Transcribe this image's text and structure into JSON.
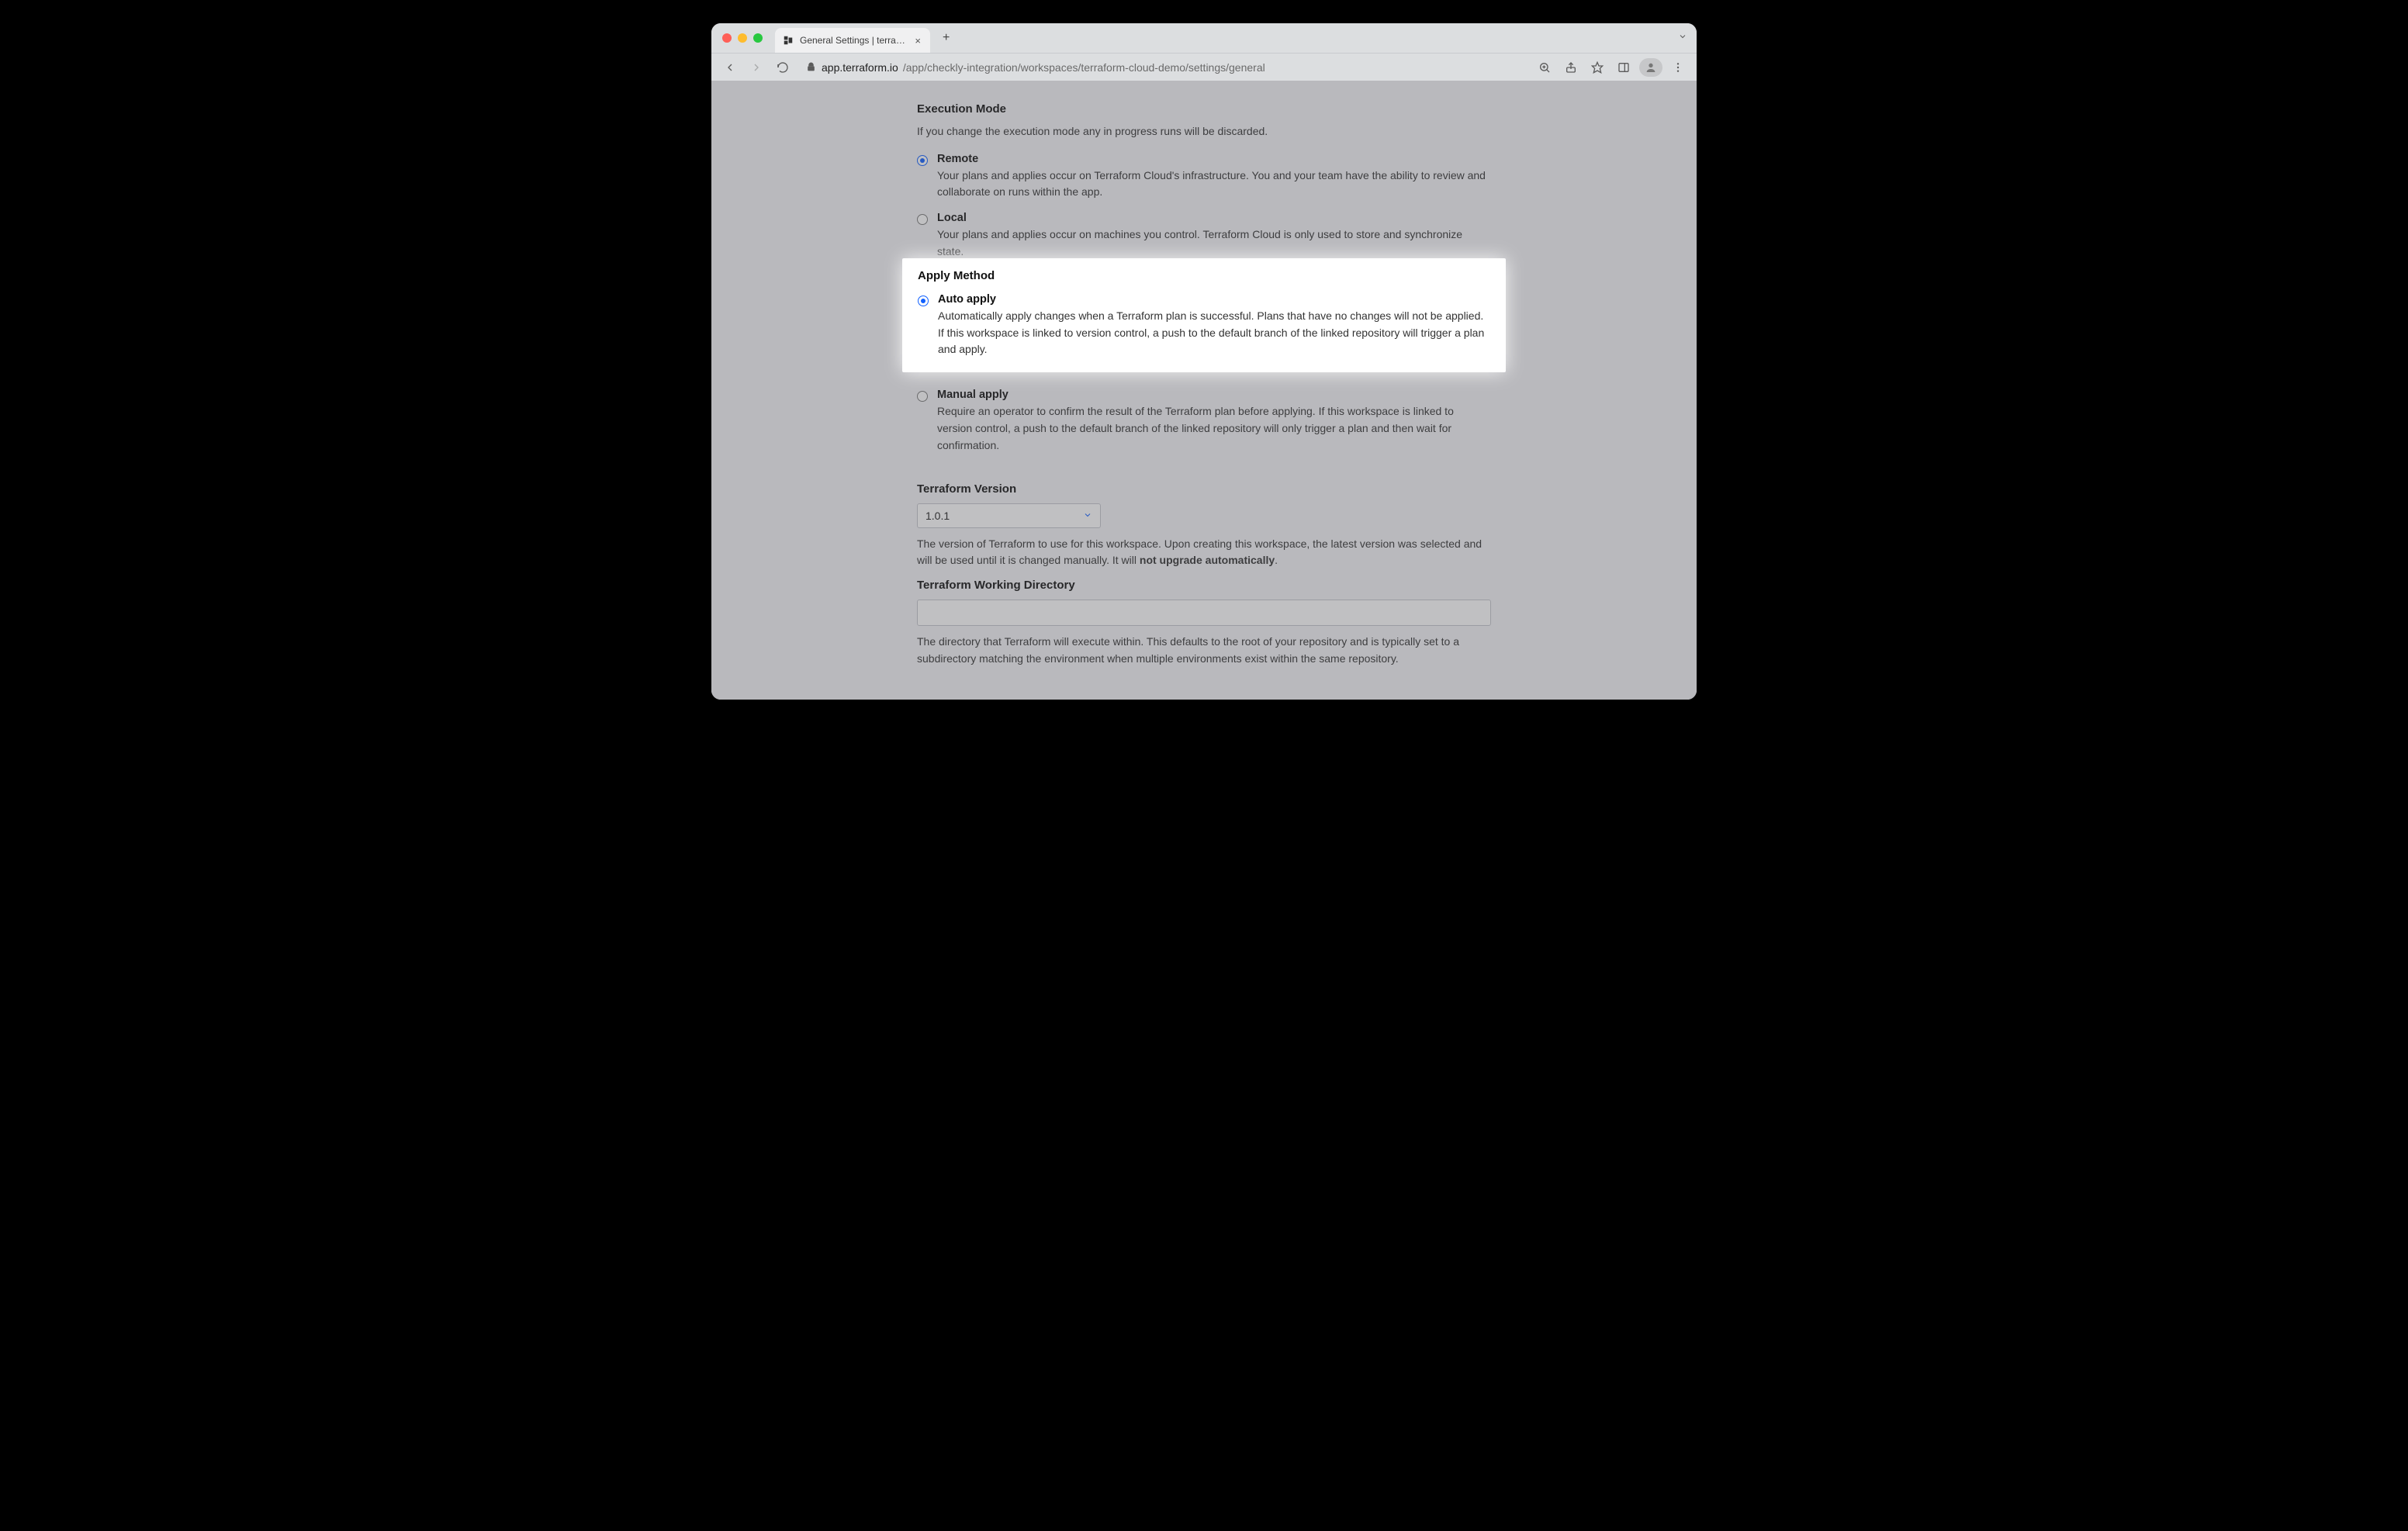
{
  "browser": {
    "tab_title": "General Settings | terraform-cl…",
    "url_host": "app.terraform.io",
    "url_path": "/app/checkly-integration/workspaces/terraform-cloud-demo/settings/general",
    "new_tab_glyph": "+",
    "close_tab_glyph": "×"
  },
  "execution_mode": {
    "heading": "Execution Mode",
    "hint": "If you change the execution mode any in progress runs will be discarded.",
    "remote": {
      "label": "Remote",
      "desc": "Your plans and applies occur on Terraform Cloud's infrastructure. You and your team have the ability to review and collaborate on runs within the app."
    },
    "local": {
      "label": "Local",
      "desc": "Your plans and applies occur on machines you control. Terraform Cloud is only used to store and synchronize state."
    }
  },
  "apply_method": {
    "heading": "Apply Method",
    "auto": {
      "label": "Auto apply",
      "desc": "Automatically apply changes when a Terraform plan is successful. Plans that have no changes will not be applied. If this workspace is linked to version control, a push to the default branch of the linked repository will trigger a plan and apply."
    },
    "manual": {
      "label": "Manual apply",
      "desc": "Require an operator to confirm the result of the Terraform plan before applying. If this workspace is linked to version control, a push to the default branch of the linked repository will only trigger a plan and then wait for confirmation."
    }
  },
  "tf_version": {
    "heading": "Terraform Version",
    "selected": "1.0.1",
    "desc_pre": "The version of Terraform to use for this workspace. Upon creating this workspace, the latest version was selected and will be used until it is changed manually. It will ",
    "desc_bold": "not upgrade automatically",
    "desc_post": "."
  },
  "working_dir": {
    "heading": "Terraform Working Directory",
    "value": "",
    "desc": "The directory that Terraform will execute within. This defaults to the root of your repository and is typically set to a subdirectory matching the environment when multiple environments exist within the same repository."
  }
}
